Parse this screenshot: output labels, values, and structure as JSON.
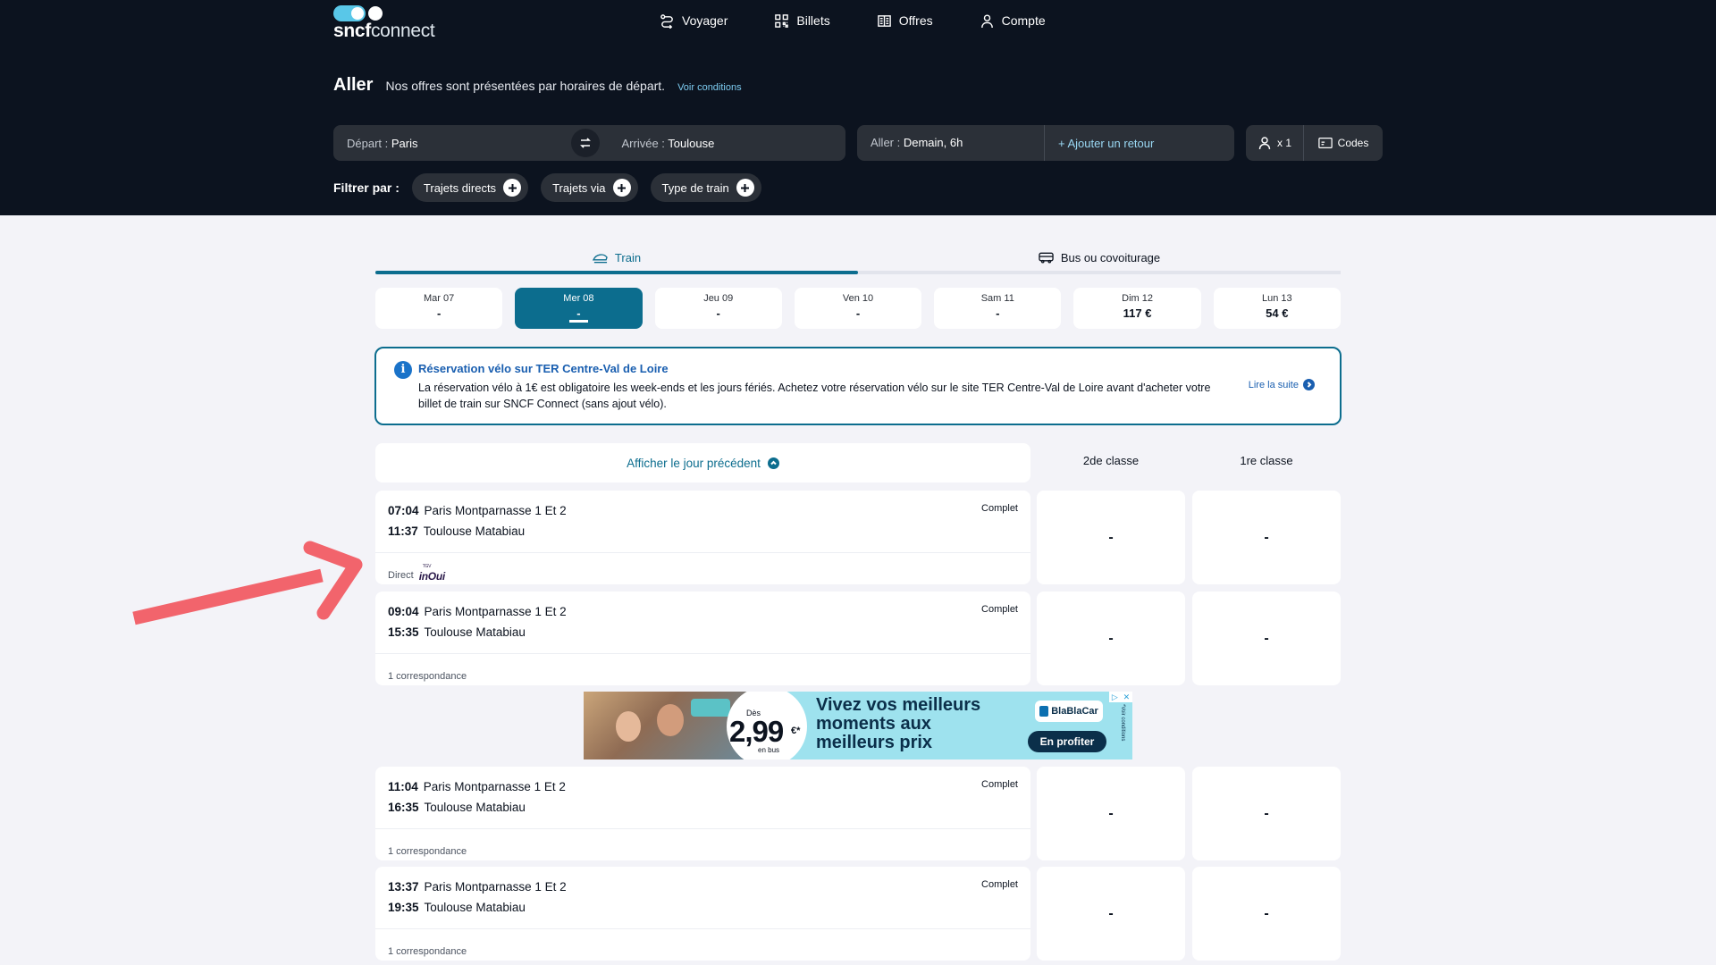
{
  "brand": {
    "logo_bold": "sncf",
    "logo_light": "connect"
  },
  "nav": [
    {
      "label": "Voyager",
      "icon": "route-icon"
    },
    {
      "label": "Billets",
      "icon": "qr-icon"
    },
    {
      "label": "Offres",
      "icon": "offers-icon"
    },
    {
      "label": "Compte",
      "icon": "user-icon"
    }
  ],
  "header": {
    "title": "Aller",
    "subtitle": "Nos offres sont présentées par horaires de départ.",
    "conditions_link": "Voir conditions"
  },
  "search": {
    "depart_label": "Départ :",
    "depart_value": "Paris",
    "arrivee_label": "Arrivée :",
    "arrivee_value": "Toulouse",
    "aller_label": "Aller :",
    "aller_value": "Demain, 6h",
    "add_return": "+ Ajouter un retour",
    "passengers": "x 1",
    "codes": "Codes"
  },
  "filters": {
    "label": "Filtrer par :",
    "chips": [
      "Trajets directs",
      "Trajets via",
      "Type de train"
    ]
  },
  "modes": {
    "train": "Train",
    "bus": "Bus ou covoiturage"
  },
  "dates": [
    {
      "day": "Mar 07",
      "price": "-"
    },
    {
      "day": "Mer 08",
      "price": "-"
    },
    {
      "day": "Jeu 09",
      "price": "-"
    },
    {
      "day": "Ven 10",
      "price": "-"
    },
    {
      "day": "Sam 11",
      "price": "-"
    },
    {
      "day": "Dim 12",
      "price": "117 €"
    },
    {
      "day": "Lun 13",
      "price": "54 €"
    }
  ],
  "info": {
    "title": "Réservation vélo sur TER Centre-Val de Loire",
    "body": "La réservation vélo à 1€ est obligatoire les week-ends et les jours fériés. Achetez votre réservation vélo sur le site TER Centre-Val de Loire avant d'acheter votre billet de train sur SNCF Connect (sans ajout vélo).",
    "more": "Lire la suite"
  },
  "results": {
    "prev_day": "Afficher le jour précédent",
    "class2": "2de classe",
    "class1": "1re classe",
    "journeys": [
      {
        "dep_time": "07:04",
        "dep_station": "Paris Montparnasse 1 Et 2",
        "arr_time": "11:37",
        "arr_station": "Toulouse Matabiau",
        "status": "Complet",
        "footer": "Direct",
        "brand": "inOui",
        "brand_small": "TGV",
        "price2": "-",
        "price1": "-"
      },
      {
        "dep_time": "09:04",
        "dep_station": "Paris Montparnasse 1 Et 2",
        "arr_time": "15:35",
        "arr_station": "Toulouse Matabiau",
        "status": "Complet",
        "footer": "1 correspondance",
        "price2": "-",
        "price1": "-"
      },
      {
        "dep_time": "11:04",
        "dep_station": "Paris Montparnasse 1 Et 2",
        "arr_time": "16:35",
        "arr_station": "Toulouse Matabiau",
        "status": "Complet",
        "footer": "1 correspondance",
        "price2": "-",
        "price1": "-"
      },
      {
        "dep_time": "13:37",
        "dep_station": "Paris Montparnasse 1 Et 2",
        "arr_time": "19:35",
        "arr_station": "Toulouse Matabiau",
        "status": "Complet",
        "footer": "1 correspondance",
        "price2": "-",
        "price1": "-"
      }
    ]
  },
  "ad": {
    "from": "Dès",
    "price": "2,99",
    "price_unit": "€*",
    "bus_label": "en bus",
    "headline": "Vivez vos meilleurs moments aux meilleurs prix",
    "brand": "BlaBlaCar",
    "cta": "En profiter",
    "side_note": "*Voir conditions"
  },
  "colors": {
    "header_bg": "#0c131f",
    "accent": "#0c6d8e",
    "info_blue": "#1a5fb0",
    "arrow": "#f2646c",
    "ad_bg": "#9ee2ee"
  }
}
